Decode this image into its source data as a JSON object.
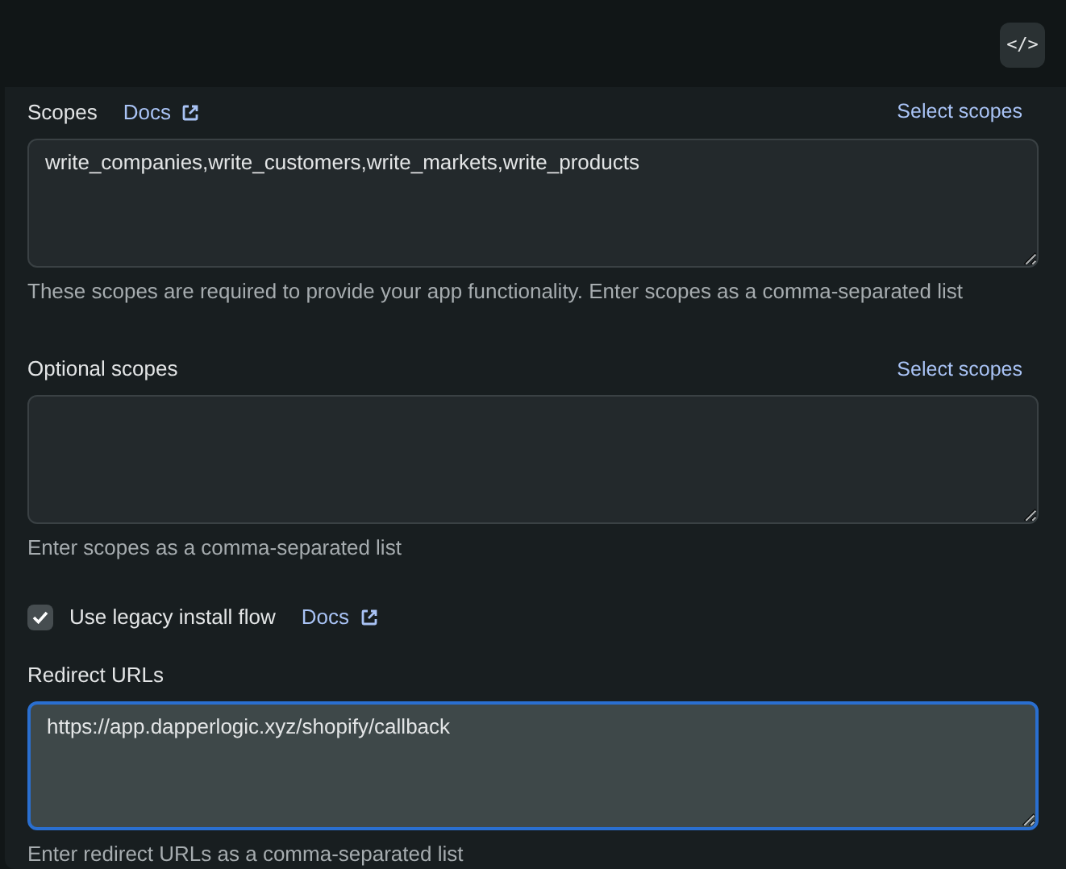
{
  "toolbar": {
    "code_button": {
      "label": "</>"
    }
  },
  "sections": [
    {
      "kind": "textarea",
      "label": "Scopes",
      "docs_link": "Docs",
      "action": "Select scopes",
      "value": "write_companies,write_customers,write_markets,write_products",
      "focused": false,
      "help": "These scopes are required to provide your app functionality. Enter scopes as a comma-separated list"
    },
    {
      "kind": "textarea",
      "label": "Optional scopes",
      "action": "Select scopes",
      "focused": false,
      "help": "Enter scopes as a comma-separated list"
    },
    {
      "kind": "checkbox",
      "label": "Use legacy install flow",
      "checked": true,
      "docs_link": "Docs"
    },
    {
      "kind": "textarea",
      "label": "Redirect URLs",
      "value": "https://app.dapperlogic.xyz/shopify/callback",
      "focused": true,
      "help": "Enter redirect URLs as a comma-separated list"
    }
  ]
}
